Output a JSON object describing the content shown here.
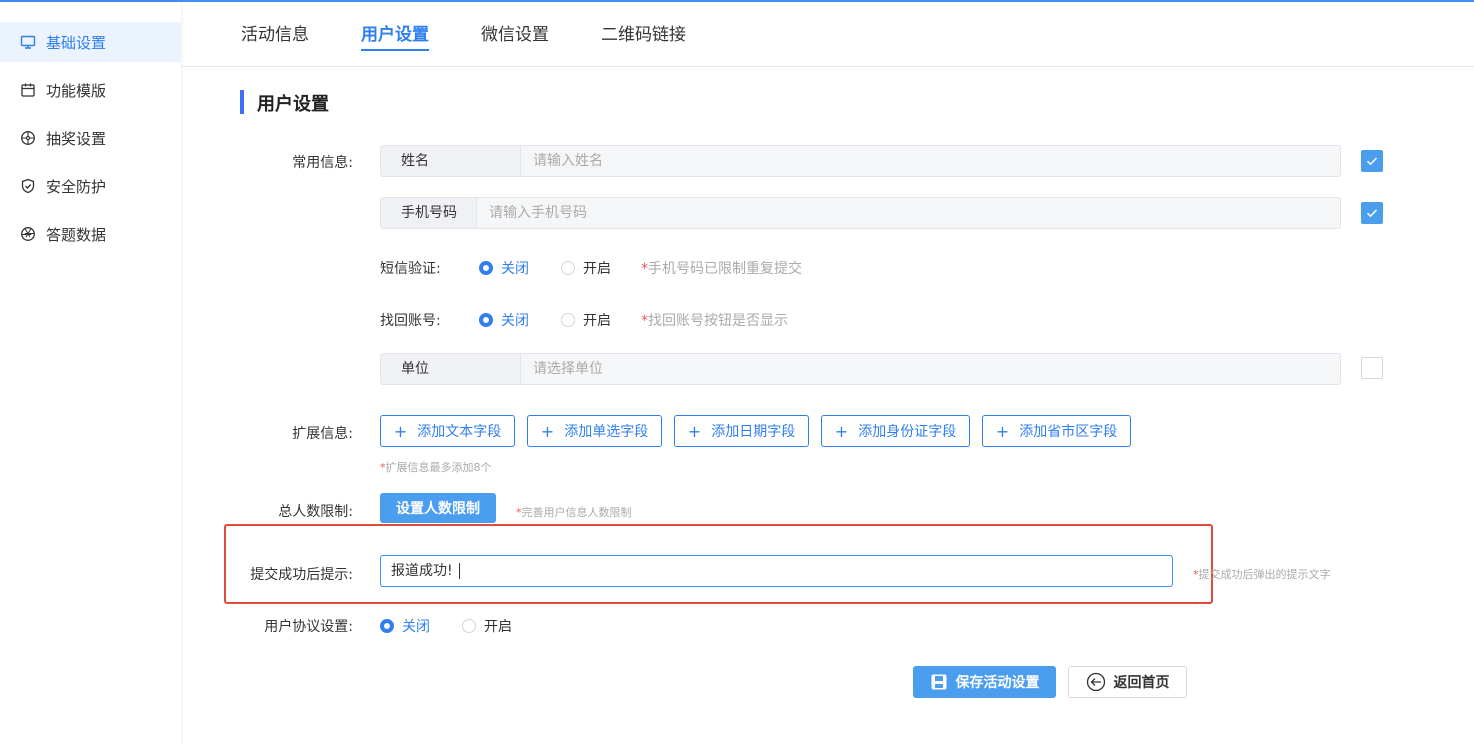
{
  "sidebar": {
    "items": [
      {
        "label": "基础设置",
        "icon": "monitor-icon",
        "active": true
      },
      {
        "label": "功能模版",
        "icon": "calendar-icon",
        "active": false
      },
      {
        "label": "抽奖设置",
        "icon": "lottery-wheel-icon",
        "active": false
      },
      {
        "label": "安全防护",
        "icon": "shield-icon",
        "active": false
      },
      {
        "label": "答题数据",
        "icon": "aperture-icon",
        "active": false
      }
    ]
  },
  "tabs": [
    {
      "label": "活动信息",
      "active": false
    },
    {
      "label": "用户设置",
      "active": true
    },
    {
      "label": "微信设置",
      "active": false
    },
    {
      "label": "二维码链接",
      "active": false
    }
  ],
  "section": {
    "title": "用户设置"
  },
  "common_info": {
    "label": "常用信息:",
    "name_field": {
      "tag": "姓名",
      "placeholder": "请输入姓名",
      "checked": true
    },
    "phone_field": {
      "tag": "手机号码",
      "placeholder": "请输入手机号码",
      "checked": true
    },
    "sms_verify": {
      "label": "短信验证:",
      "off_label": "关闭",
      "on_label": "开启",
      "selected": "关闭",
      "hint_star": "*",
      "hint": "手机号码已限制重复提交"
    },
    "recover_account": {
      "label": "找回账号:",
      "off_label": "关闭",
      "on_label": "开启",
      "selected": "关闭",
      "hint_star": "*",
      "hint": "找回账号按钮是否显示"
    },
    "unit_field": {
      "tag": "单位",
      "placeholder": "请选择单位",
      "checked": false
    }
  },
  "extended_info": {
    "label": "扩展信息:",
    "buttons": [
      "添加文本字段",
      "添加单选字段",
      "添加日期字段",
      "添加身份证字段",
      "添加省市区字段"
    ],
    "hint_star": "*",
    "hint": "扩展信息最多添加8个"
  },
  "total_limit": {
    "label": "总人数限制:",
    "button": "设置人数限制",
    "hint_star": "*",
    "hint": "完善用户信息人数限制"
  },
  "success_tip": {
    "label": "提交成功后提示:",
    "value": "报道成功!",
    "hint_star": "*",
    "hint": "提交成功后弹出的提示文字"
  },
  "agreement": {
    "label": "用户协议设置:",
    "off_label": "关闭",
    "on_label": "开启",
    "selected": "关闭"
  },
  "actions": {
    "save": "保存活动设置",
    "back": "返回首页"
  },
  "colors": {
    "accent": "#2f7ff0",
    "highlight_border": "#e04c3c"
  }
}
